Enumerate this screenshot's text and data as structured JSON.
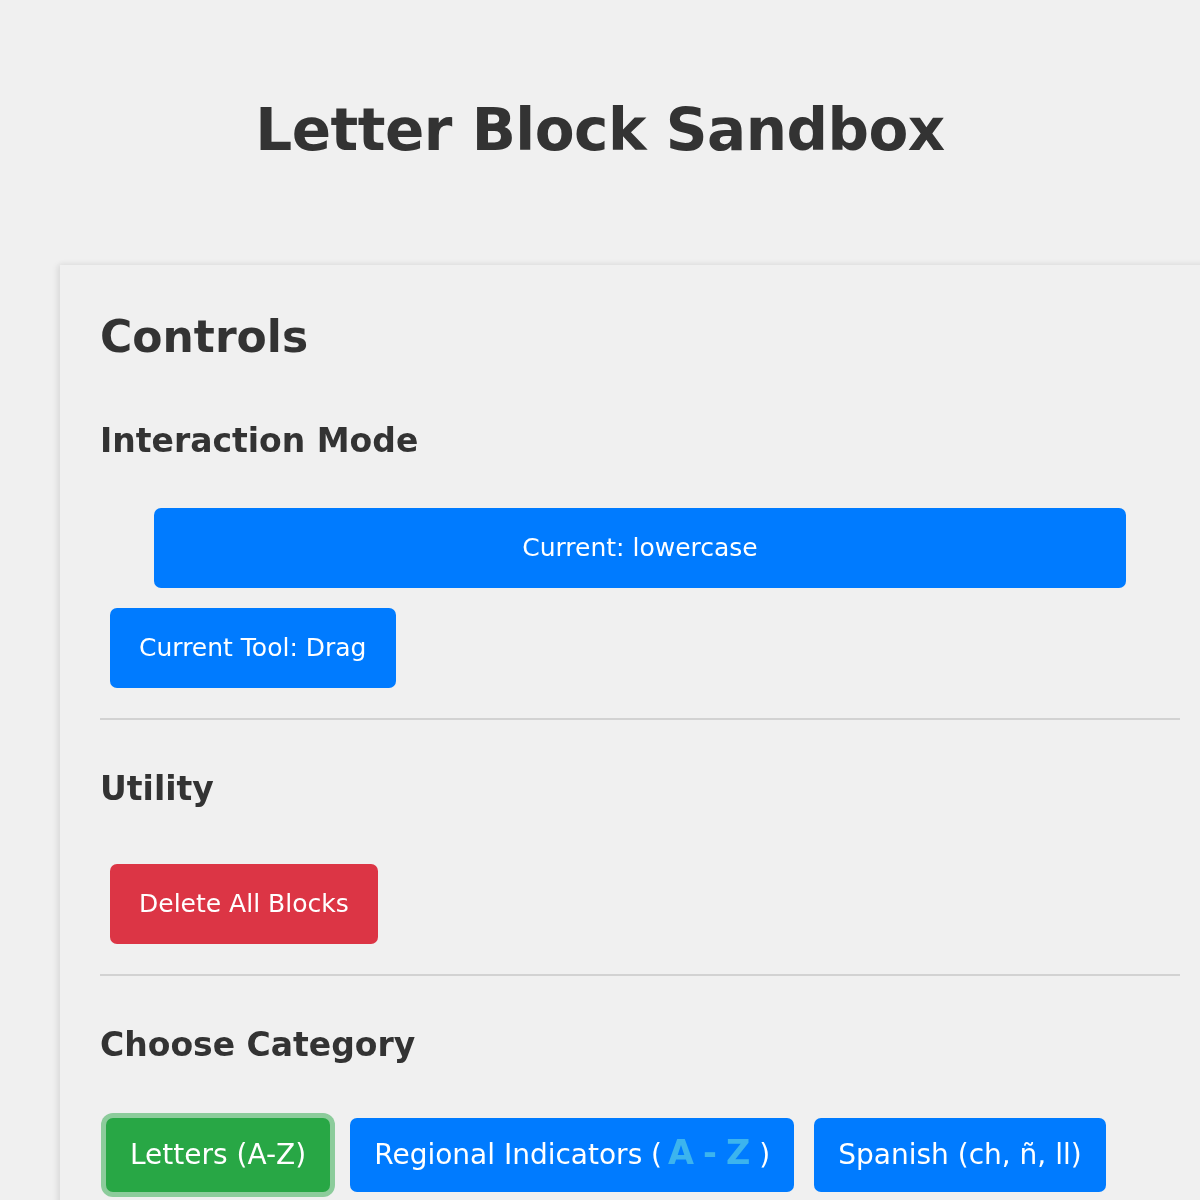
{
  "page": {
    "title": "Letter Block Sandbox"
  },
  "controls": {
    "heading": "Controls",
    "interaction_mode": {
      "heading": "Interaction Mode",
      "case_button": "Current: lowercase",
      "tool_button": "Current Tool: Drag"
    },
    "utility": {
      "heading": "Utility",
      "delete_button": "Delete All Blocks"
    },
    "category": {
      "heading": "Choose Category",
      "options": [
        {
          "label": "Letters (A-Z)",
          "selected": true
        },
        {
          "label": "Regional Indicators (**A-Z**)",
          "selected": false
        },
        {
          "label": "Spanish (ch, ñ, ll)",
          "selected": false
        }
      ]
    }
  }
}
